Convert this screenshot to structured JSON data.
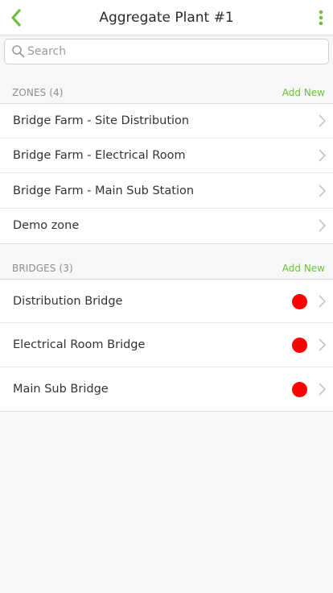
{
  "header": {
    "title": "Aggregate Plant #1",
    "back_icon": "chevron-left-icon",
    "menu_icon": "kebab-menu-icon"
  },
  "search": {
    "placeholder": "Search",
    "value": ""
  },
  "zones": {
    "title": "ZONES (4)",
    "add_label": "Add New",
    "items": [
      {
        "label": "Bridge Farm - Site Distribution"
      },
      {
        "label": "Bridge Farm - Electrical Room"
      },
      {
        "label": "Bridge Farm - Main Sub Station"
      },
      {
        "label": "Demo zone"
      }
    ]
  },
  "bridges": {
    "title": "BRIDGES (3)",
    "add_label": "Add New",
    "items": [
      {
        "label": "Distribution Bridge",
        "status_color": "#ff0000"
      },
      {
        "label": "Electrical Room Bridge",
        "status_color": "#ff0000"
      },
      {
        "label": "Main Sub Bridge",
        "status_color": "#ff0000"
      }
    ]
  },
  "colors": {
    "accent": "#6fbf3d",
    "status_offline": "#ff0000"
  }
}
